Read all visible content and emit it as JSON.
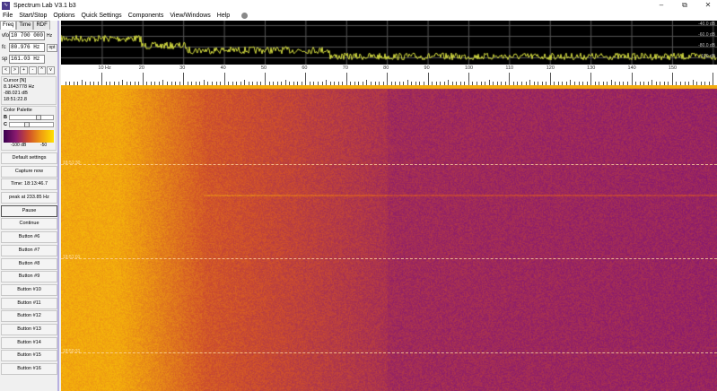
{
  "window": {
    "title": "Spectrum Lab V3.1 b3",
    "restore_icon": "restore-icon",
    "close_icon": "close-icon"
  },
  "menu": [
    "File",
    "Start/Stop",
    "Options",
    "Quick Settings",
    "Components",
    "View/Windows",
    "Help"
  ],
  "left": {
    "tabs": [
      "Freq",
      "Time",
      "RDF"
    ],
    "vfo": {
      "label": "vfo",
      "value": "10 700 000",
      "unit": "Hz"
    },
    "fc": {
      "label": "fc",
      "value": "80.976 Hz",
      "button": "opt"
    },
    "sp": {
      "label": "sp",
      "value": "161.03 Hz"
    },
    "nav": [
      "<",
      ">",
      "+",
      "-",
      "^",
      "v"
    ],
    "cursor": {
      "title": "Cursor [N]",
      "freq": "8.1643778 Hz",
      "level": "-88.021 dB",
      "time": "18:51:22.8"
    },
    "palette": {
      "title": "Color Palette",
      "b_label": "B",
      "c_label": "C",
      "b_value": 0.8,
      "c_value": 0.45,
      "min_label": "-100 dB",
      "max_label": "-50",
      "colors": [
        "#3a0050",
        "#8a1a6e",
        "#d0502a",
        "#f0a010",
        "#ffe000"
      ]
    },
    "buttons": [
      "Default settings",
      "Capture now",
      "Time:  18:13:46.7",
      "peak at 233.85 Hz",
      "Pause",
      "Continue",
      "Button #6",
      "Button #7",
      "Button #8",
      "Button #9",
      "Button #10",
      "Button #11",
      "Button #12",
      "Button #13",
      "Button #14",
      "Button #15",
      "Button #16"
    ]
  },
  "spectrum": {
    "db_labels": [
      "-40.0 dB",
      "-60.0 dB",
      "-80.0 dB",
      "-100 dB"
    ],
    "trace_color": "#d8e040",
    "freq_labels": [
      "10 Hz",
      "20",
      "30",
      "40",
      "50",
      "60",
      "70",
      "80",
      "90",
      "100",
      "110",
      "120",
      "130",
      "140",
      "150"
    ],
    "freq_range_hz": [
      0,
      161.03
    ]
  },
  "waterfall": {
    "time_labels": [
      "18:51:30",
      "18:51:01",
      "18:50:31"
    ]
  }
}
